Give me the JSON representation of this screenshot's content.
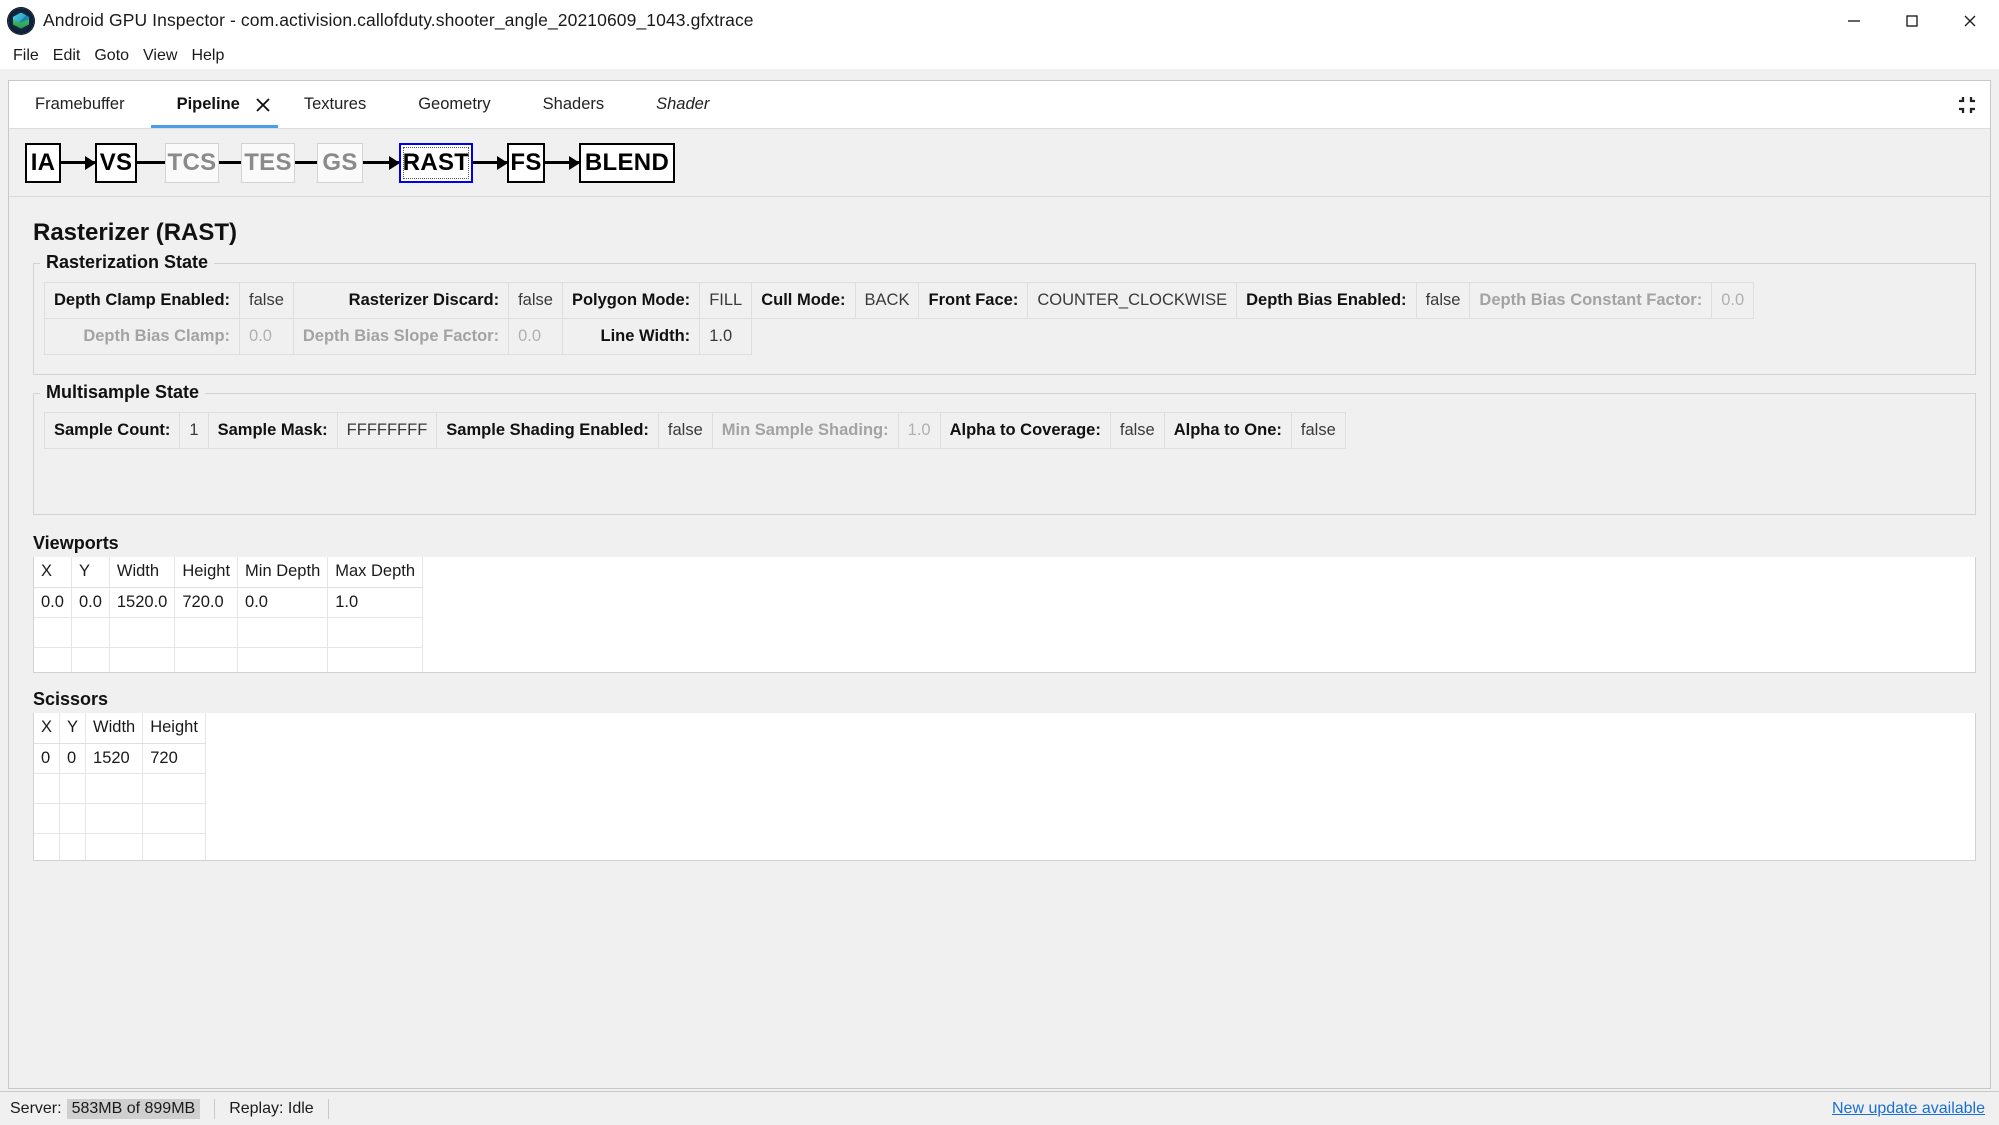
{
  "window": {
    "title": "Android GPU Inspector - com.activision.callofduty.shooter_angle_20210609_1043.gfxtrace",
    "app_icon": "agi-cube-icon",
    "controls": {
      "minimize": "minimize-icon",
      "maximize": "maximize-icon",
      "close": "close-icon"
    }
  },
  "menubar": {
    "items": [
      {
        "label": "File"
      },
      {
        "label": "Edit"
      },
      {
        "label": "Goto"
      },
      {
        "label": "View"
      },
      {
        "label": "Help"
      }
    ]
  },
  "tabs": {
    "items": [
      {
        "label": "Framebuffer",
        "active": false,
        "italic": false,
        "closable": false
      },
      {
        "label": "Pipeline",
        "active": true,
        "italic": false,
        "closable": true
      },
      {
        "label": "Textures",
        "active": false,
        "italic": false,
        "closable": false
      },
      {
        "label": "Geometry",
        "active": false,
        "italic": false,
        "closable": false
      },
      {
        "label": "Shaders",
        "active": false,
        "italic": false,
        "closable": false
      },
      {
        "label": "Shader",
        "active": false,
        "italic": true,
        "closable": false
      }
    ],
    "close_icon": "close-icon",
    "collapse_icon": "collapse-panels-icon"
  },
  "pipeline": {
    "stages": [
      {
        "label": "IA",
        "state": "enabled"
      },
      {
        "label": "VS",
        "state": "enabled"
      },
      {
        "label": "TCS",
        "state": "disabled"
      },
      {
        "label": "TES",
        "state": "disabled"
      },
      {
        "label": "GS",
        "state": "disabled"
      },
      {
        "label": "RAST",
        "state": "selected"
      },
      {
        "label": "FS",
        "state": "enabled"
      },
      {
        "label": "BLEND",
        "state": "enabled"
      }
    ]
  },
  "page": {
    "title": "Rasterizer (RAST)"
  },
  "rasterization_state": {
    "title": "Rasterization State",
    "rows": [
      [
        {
          "key": "Depth Clamp Enabled:",
          "value": "false",
          "dim": false
        },
        {
          "key": "Rasterizer Discard:",
          "value": "false",
          "dim": false
        },
        {
          "key": "Polygon Mode:",
          "value": "FILL",
          "dim": false
        },
        {
          "key": "Cull Mode:",
          "value": "BACK",
          "dim": false
        },
        {
          "key": "Front Face:",
          "value": "COUNTER_CLOCKWISE",
          "dim": false
        },
        {
          "key": "Depth Bias Enabled:",
          "value": "false",
          "dim": false
        },
        {
          "key": "Depth Bias Constant Factor:",
          "value": "0.0",
          "dim": true
        }
      ],
      [
        {
          "key": "Depth Bias Clamp:",
          "value": "0.0",
          "dim": true
        },
        {
          "key": "Depth Bias Slope Factor:",
          "value": "0.0",
          "dim": true
        },
        {
          "key": "Line Width:",
          "value": "1.0",
          "dim": false
        }
      ]
    ]
  },
  "multisample_state": {
    "title": "Multisample State",
    "rows": [
      [
        {
          "key": "Sample Count:",
          "value": "1",
          "dim": false
        },
        {
          "key": "Sample Mask:",
          "value": "FFFFFFFF",
          "dim": false
        },
        {
          "key": "Sample Shading Enabled:",
          "value": "false",
          "dim": false
        },
        {
          "key": "Min Sample Shading:",
          "value": "1.0",
          "dim": true
        },
        {
          "key": "Alpha to Coverage:",
          "value": "false",
          "dim": false
        },
        {
          "key": "Alpha to One:",
          "value": "false",
          "dim": false
        }
      ]
    ]
  },
  "viewports": {
    "title": "Viewports",
    "columns": [
      "X",
      "Y",
      "Width",
      "Height",
      "Min Depth",
      "Max Depth"
    ],
    "rows": [
      [
        "0.0",
        "0.0",
        "1520.0",
        "720.0",
        "0.0",
        "1.0"
      ]
    ],
    "empty_rows": 3
  },
  "scissors": {
    "title": "Scissors",
    "columns": [
      "X",
      "Y",
      "Width",
      "Height"
    ],
    "rows": [
      [
        "0",
        "0",
        "1520",
        "720"
      ]
    ],
    "empty_rows": 3
  },
  "statusbar": {
    "server_label": "Server:",
    "server_memory": "583MB of 899MB",
    "replay_label": "Replay: Idle",
    "update_link": "New update available"
  }
}
